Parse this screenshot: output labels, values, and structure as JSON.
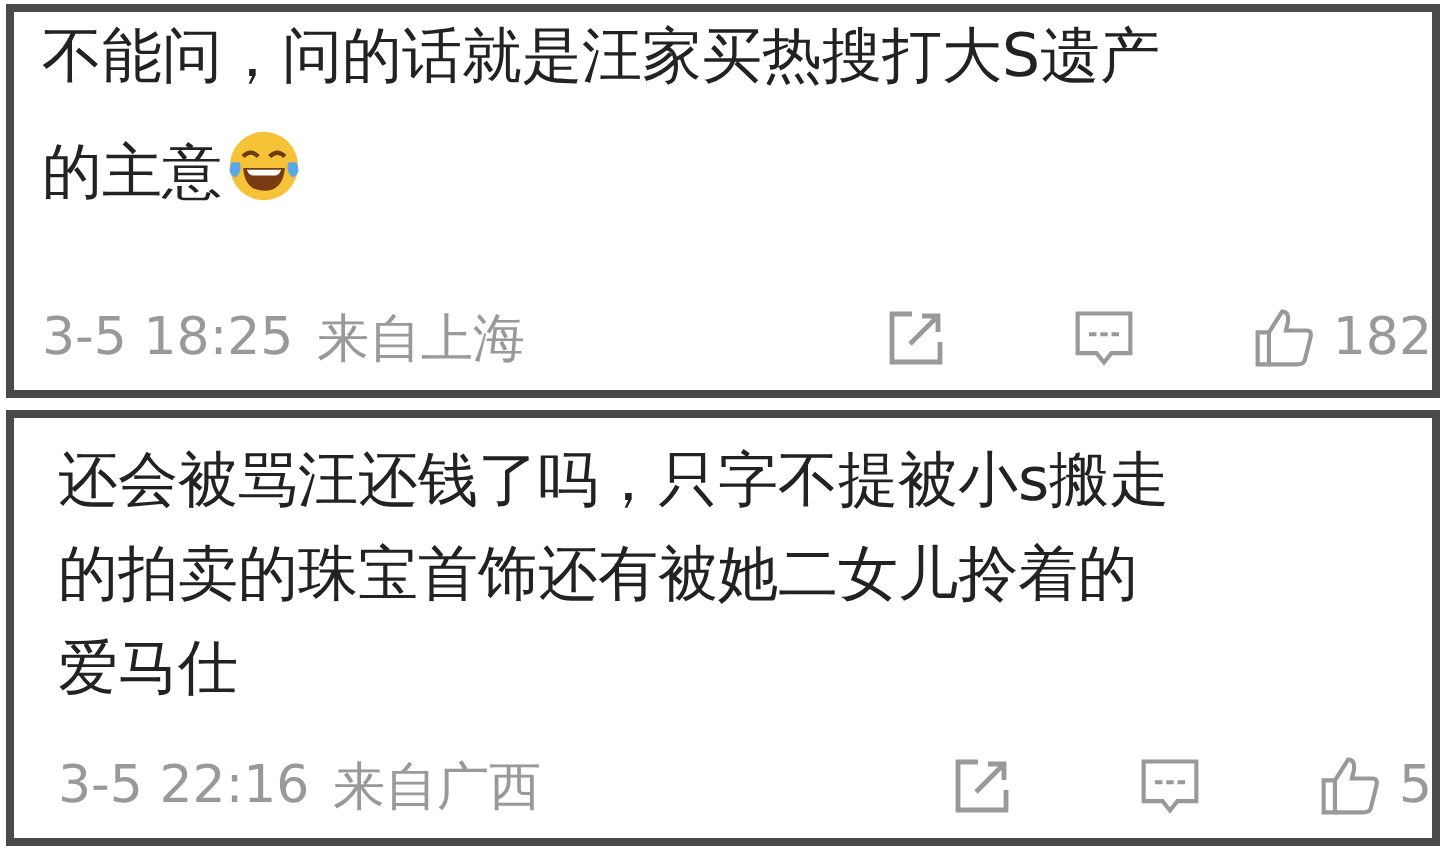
{
  "comments": [
    {
      "lines": [
        "不能问，问的话就是汪家买热搜打大S遗产",
        "的主意"
      ],
      "emoji": true,
      "time": "3-5 18:25",
      "location": "来自上海",
      "likes": "182"
    },
    {
      "lines": [
        "还会被骂汪还钱了吗，只字不提被小s搬走",
        "的拍卖的珠宝首饰还有被她二女儿拎着的",
        "爱马仕"
      ],
      "time": "3-5 22:16",
      "location": "来自广西",
      "likes": "5"
    }
  ]
}
